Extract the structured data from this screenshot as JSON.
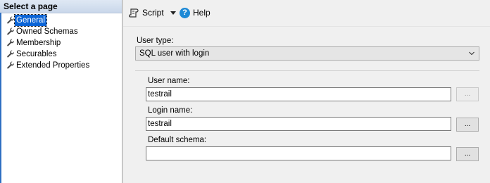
{
  "sidebar": {
    "header": "Select a page",
    "items": [
      {
        "label": "General",
        "icon": "wrench-icon",
        "selected": true
      },
      {
        "label": "Owned Schemas",
        "icon": "wrench-icon"
      },
      {
        "label": "Membership",
        "icon": "wrench-icon"
      },
      {
        "label": "Securables",
        "icon": "wrench-icon"
      },
      {
        "label": "Extended Properties",
        "icon": "wrench-icon"
      }
    ]
  },
  "toolbar": {
    "script_label": "Script",
    "script_icon": "script-icon",
    "help_label": "Help",
    "help_icon": "help-icon",
    "help_glyph": "?"
  },
  "form": {
    "user_type": {
      "label": "User type:",
      "value": "SQL user with login"
    },
    "user_name": {
      "label": "User name:",
      "value": "testrail",
      "button": "...",
      "button_enabled": false
    },
    "login_name": {
      "label": "Login name:",
      "value": "testrail",
      "button": "..."
    },
    "default_schema": {
      "label": "Default schema:",
      "value": "",
      "button": "..."
    }
  },
  "colors": {
    "accent": "#0a64d6",
    "help": "#1e8ad6"
  }
}
